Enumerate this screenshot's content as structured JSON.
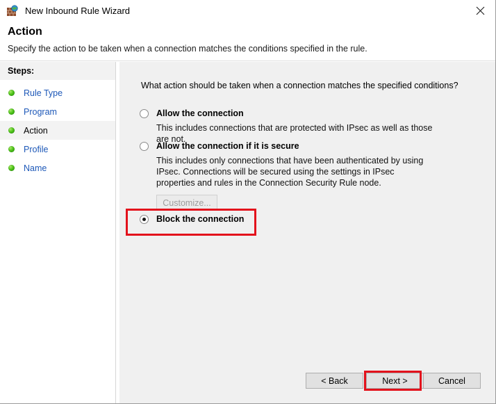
{
  "window": {
    "title": "New Inbound Rule Wizard",
    "icon": "firewall-globe-icon",
    "close_label": "✕"
  },
  "header": {
    "title": "Action",
    "subtitle": "Specify the action to be taken when a connection matches the conditions specified in the rule."
  },
  "sidebar": {
    "heading": "Steps:",
    "items": [
      {
        "label": "Rule Type",
        "state": "completed"
      },
      {
        "label": "Program",
        "state": "completed"
      },
      {
        "label": "Action",
        "state": "current"
      },
      {
        "label": "Profile",
        "state": "completed"
      },
      {
        "label": "Name",
        "state": "completed"
      }
    ]
  },
  "main": {
    "question": "What action should be taken when a connection matches the specified conditions?",
    "options": [
      {
        "title": "Allow the connection",
        "description": "This includes connections that are protected with IPsec as well as those are not.",
        "selected": false
      },
      {
        "title": "Allow the connection if it is secure",
        "description": "This includes only connections that have been authenticated by using IPsec.  Connections will be secured using the settings in IPsec properties and rules in the Connection Security Rule node.",
        "selected": false,
        "button_label": "Customize...",
        "button_enabled": false
      },
      {
        "title": "Block the connection",
        "description": "",
        "selected": true,
        "highlighted": true
      }
    ]
  },
  "footer": {
    "back_label": "< Back",
    "next_label": "Next >",
    "cancel_label": "Cancel",
    "next_highlighted": true
  },
  "colors": {
    "annotation_red": "#e3121c",
    "link_blue": "#1d58b8",
    "panel_gray": "#f0f0f0",
    "bullet_green": "#4fc41a"
  }
}
